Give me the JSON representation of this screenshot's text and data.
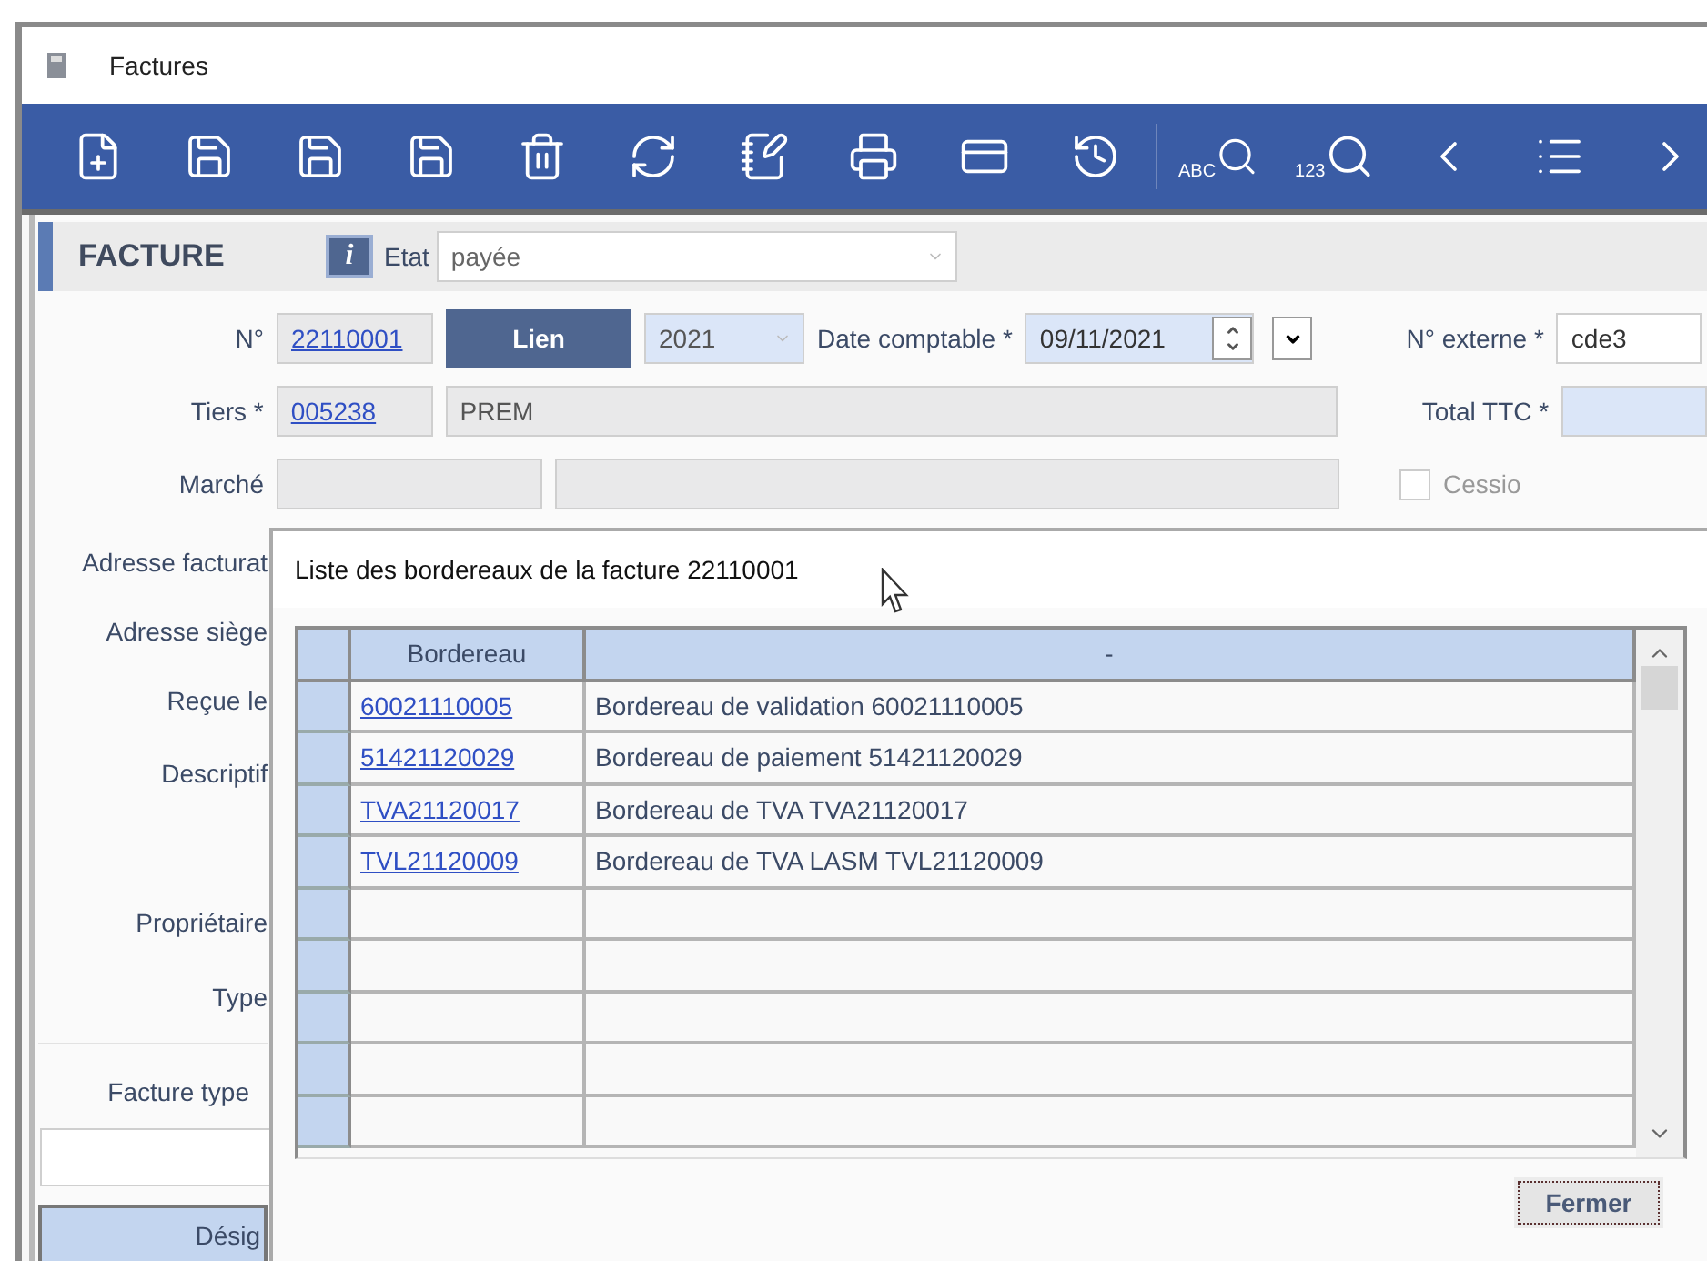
{
  "window": {
    "title": "Factures"
  },
  "toolbar": {
    "search_labels": [
      "ABC",
      "123"
    ]
  },
  "form": {
    "title": "FACTURE",
    "info_button": "i",
    "etat": {
      "label": "Etat",
      "value": "payée"
    },
    "numero": {
      "label": "N°",
      "value": "22110001"
    },
    "lien_button": "Lien",
    "annee": {
      "value": "2021"
    },
    "date_comptable": {
      "label": "Date comptable *",
      "value": "09/11/2021"
    },
    "numero_externe": {
      "label": "N° externe *",
      "value": "cde3"
    },
    "tiers": {
      "label": "Tiers *",
      "code": "005238",
      "name": "PREM"
    },
    "total_ttc": {
      "label": "Total TTC *"
    },
    "marche": {
      "label": "Marché"
    },
    "cession": {
      "label": "Cessio",
      "checked": false
    },
    "side_labels": [
      "Adresse facturat",
      "Adresse siège",
      "Reçue le",
      "Descriptif",
      "Propriétaire",
      "Type"
    ],
    "facture_type": {
      "label": "Facture type"
    },
    "lines_header": "Désig"
  },
  "dialog": {
    "title": "Liste des bordereaux de la facture 22110001",
    "columns": [
      "Bordereau",
      "-"
    ],
    "rows": [
      {
        "bordereau": "60021110005",
        "description": "Bordereau de validation 60021110005"
      },
      {
        "bordereau": "51421120029",
        "description": "Bordereau de paiement 51421120029"
      },
      {
        "bordereau": "TVA21120017",
        "description": "Bordereau de TVA TVA21120017"
      },
      {
        "bordereau": "TVL21120009",
        "description": "Bordereau de TVA LASM TVL21120009"
      }
    ],
    "close_button": "Fermer"
  }
}
